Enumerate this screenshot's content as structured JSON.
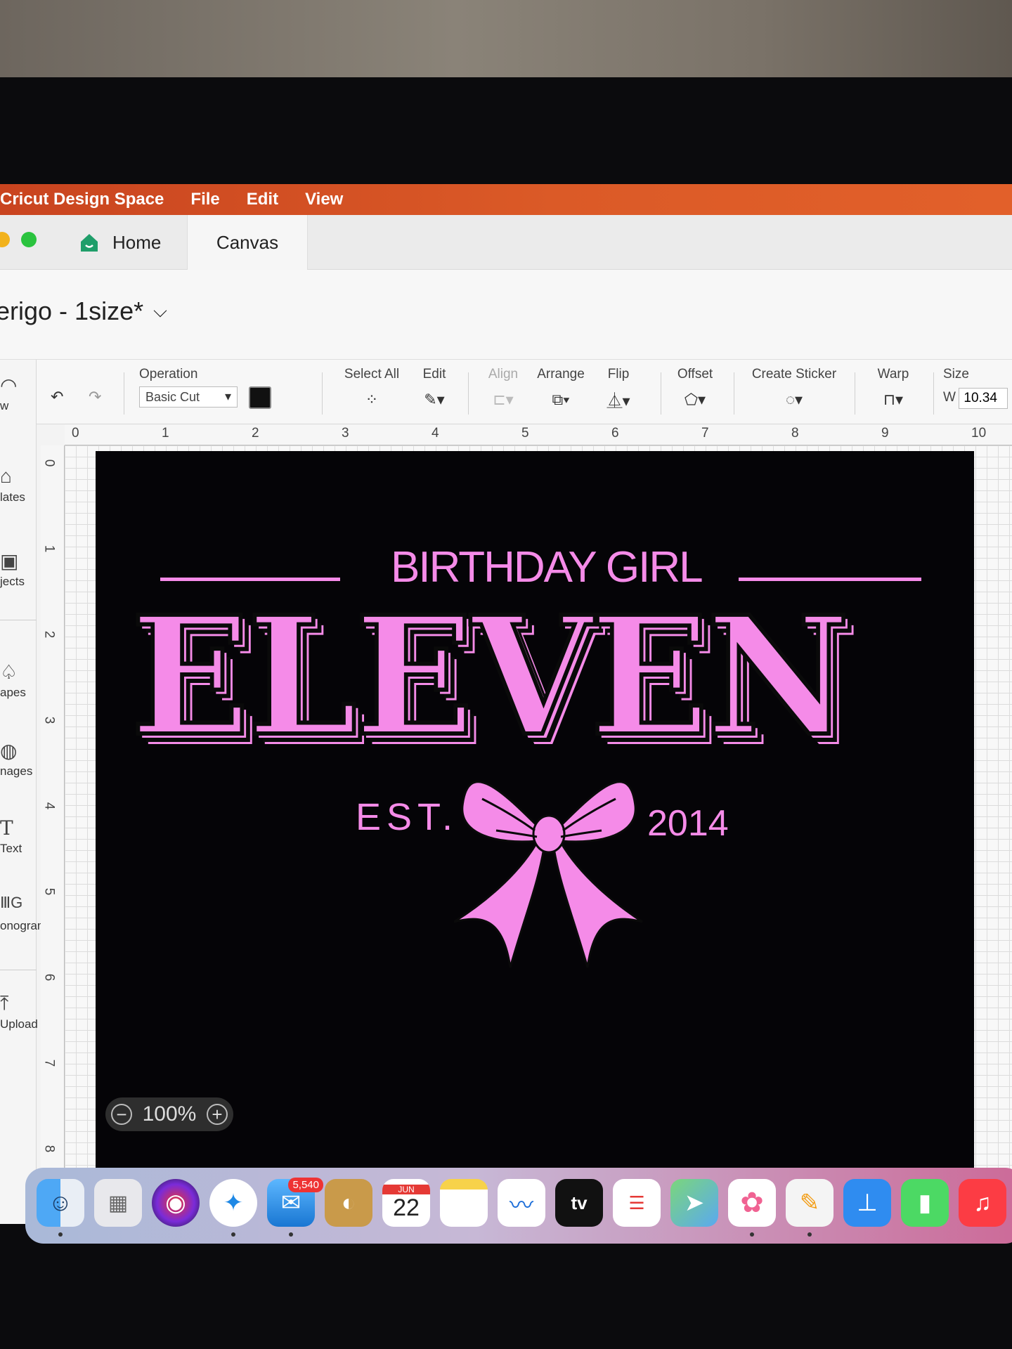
{
  "menubar": {
    "app_name": "Cricut Design Space",
    "items": [
      "File",
      "Edit",
      "View"
    ]
  },
  "tabs": {
    "home": "Home",
    "canvas": "Canvas"
  },
  "project": {
    "title": "erigo - 1size*"
  },
  "toolbar": {
    "operation_label": "Operation",
    "operation_value": "Basic Cut",
    "select_all": "Select All",
    "edit": "Edit",
    "align": "Align",
    "arrange": "Arrange",
    "flip": "Flip",
    "offset": "Offset",
    "create_sticker": "Create Sticker",
    "warp": "Warp",
    "size": "Size",
    "width_label": "W",
    "width_value": "10.34"
  },
  "sidebar": {
    "items": [
      {
        "label": "w",
        "icon": "new-icon"
      },
      {
        "label": "lates",
        "icon": "shirt-icon"
      },
      {
        "label": "jects",
        "icon": "projects-icon"
      },
      {
        "label": "apes",
        "icon": "shapes-icon"
      },
      {
        "label": "nages",
        "icon": "images-icon"
      },
      {
        "label": "Text",
        "icon": "text-icon"
      },
      {
        "label": "onogram",
        "icon": "monogram-icon"
      },
      {
        "label": "Upload",
        "icon": "upload-icon"
      }
    ]
  },
  "rulers": {
    "horizontal": [
      "0",
      "1",
      "2",
      "3",
      "4",
      "5",
      "6",
      "7",
      "8",
      "9",
      "10"
    ],
    "vertical": [
      "0",
      "1",
      "2",
      "3",
      "4",
      "5",
      "6",
      "7",
      "8"
    ]
  },
  "design": {
    "top_line": "BIRTHDAY GIRL",
    "main_word": "ELEVEN",
    "est": "EST.",
    "year": "2014",
    "color": "#f58be8"
  },
  "zoom": {
    "level": "100%"
  },
  "dock": {
    "mail_badge": "5,540",
    "calendar_month": "JUN",
    "calendar_day": "22",
    "tv_label": "tv"
  }
}
